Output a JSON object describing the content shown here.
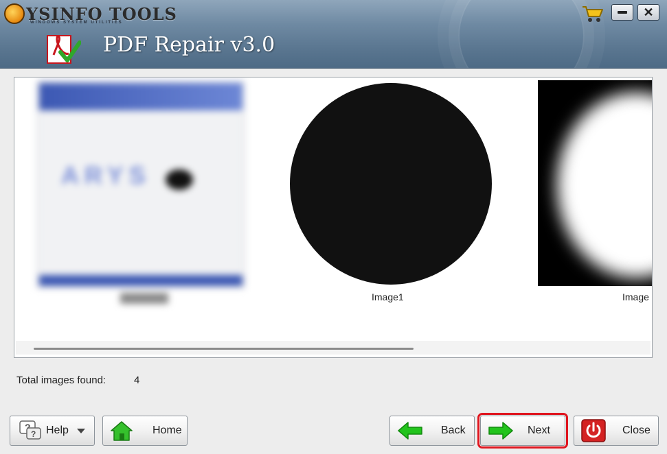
{
  "header": {
    "brand_name": "YSINFO TOOLS",
    "brand_tagline": "WINDOWS SYSTEM UTILITIES",
    "app_title": "PDF Repair v3.0"
  },
  "preview": {
    "images": [
      {
        "label": "Image1"
      },
      {
        "label": "Image"
      }
    ]
  },
  "summary": {
    "total_label": "Total images found:",
    "total_value": "4"
  },
  "buttons": {
    "help": "Help",
    "home": "Home",
    "back": "Back",
    "next": "Next",
    "close": "Close"
  },
  "colors": {
    "highlight": "#e0161f",
    "arrow_green": "#22c41c",
    "close_red": "#d42222"
  }
}
